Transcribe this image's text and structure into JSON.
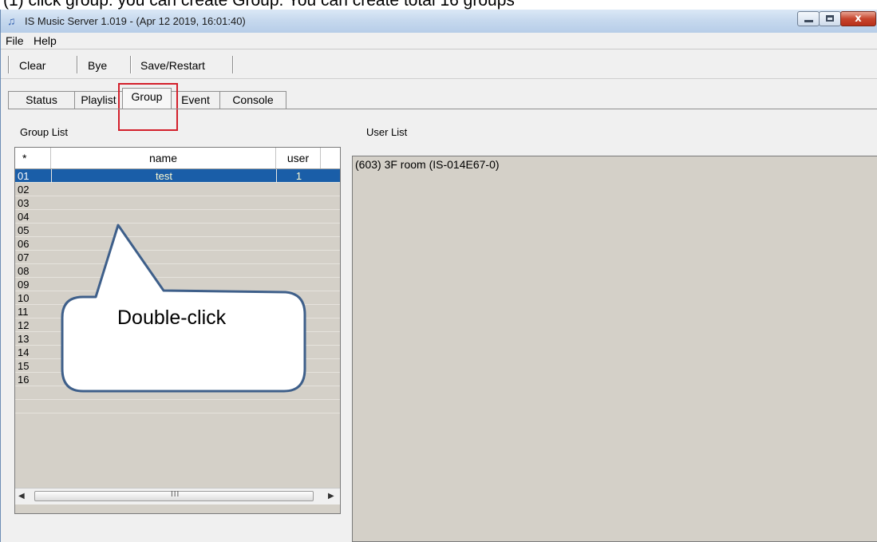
{
  "caption": "(1) click group: you can create Group. You can create total 16 groups",
  "window": {
    "title": "IS Music Server 1.019 - (Apr 12 2019, 16:01:40)",
    "app_icon": "music-note-icon",
    "close_glyph": "x"
  },
  "menu": {
    "items": [
      "File",
      "Help"
    ]
  },
  "toolbar": {
    "buttons": [
      "Clear",
      "Bye",
      "Save/Restart"
    ]
  },
  "tabs": {
    "items": [
      "Status",
      "Playlist",
      "Group",
      "Event",
      "Console"
    ],
    "active": "Group"
  },
  "group_list": {
    "label": "Group List",
    "columns": [
      "*",
      "name",
      "user"
    ],
    "rows": [
      {
        "id": "01",
        "name": "test",
        "user": "1",
        "selected": true
      },
      {
        "id": "02",
        "name": "",
        "user": ""
      },
      {
        "id": "03",
        "name": "",
        "user": ""
      },
      {
        "id": "04",
        "name": "",
        "user": ""
      },
      {
        "id": "05",
        "name": "",
        "user": ""
      },
      {
        "id": "06",
        "name": "",
        "user": ""
      },
      {
        "id": "07",
        "name": "",
        "user": ""
      },
      {
        "id": "08",
        "name": "",
        "user": ""
      },
      {
        "id": "09",
        "name": "",
        "user": ""
      },
      {
        "id": "10",
        "name": "",
        "user": ""
      },
      {
        "id": "11",
        "name": "",
        "user": ""
      },
      {
        "id": "12",
        "name": "",
        "user": ""
      },
      {
        "id": "13",
        "name": "",
        "user": ""
      },
      {
        "id": "14",
        "name": "",
        "user": ""
      },
      {
        "id": "15",
        "name": "",
        "user": ""
      },
      {
        "id": "16",
        "name": "",
        "user": ""
      }
    ],
    "scroll_grip": "III"
  },
  "user_list": {
    "label": "User List",
    "items": [
      "(603) 3F room (IS-014E67-0)"
    ]
  },
  "annotation": {
    "text": "Double-click"
  },
  "colors": {
    "selection": "#1a5ea8",
    "highlight_box": "#d31f2b",
    "callout_stroke": "#3e5f8a",
    "list_bg": "#d4d0c8"
  }
}
